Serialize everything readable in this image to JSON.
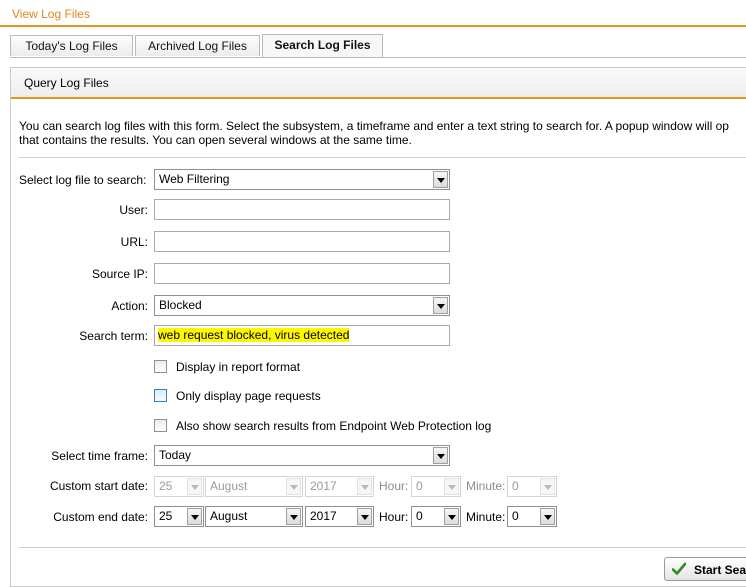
{
  "page": {
    "title": "View Log Files"
  },
  "tabs": [
    {
      "label": "Today's Log Files",
      "active": false
    },
    {
      "label": "Archived Log Files",
      "active": false
    },
    {
      "label": "Search Log Files",
      "active": true
    }
  ],
  "panel": {
    "title": "Query Log Files",
    "intro_line1": "You can search log files with this form. Select the subsystem, a timeframe and enter a text string to search for. A popup window will op",
    "intro_line2": "that contains the results. You can open several windows at the same time."
  },
  "form": {
    "log_file": {
      "label": "Select log file to search:",
      "value": "Web Filtering"
    },
    "user": {
      "label": "User:",
      "value": ""
    },
    "url": {
      "label": "URL:",
      "value": ""
    },
    "source_ip": {
      "label": "Source IP:",
      "value": ""
    },
    "action": {
      "label": "Action:",
      "value": "Blocked"
    },
    "search_term": {
      "label": "Search term:",
      "value": "web request blocked, virus detected",
      "highlight": "#fff700"
    },
    "checkboxes": {
      "report_format": {
        "label": "Display in report format",
        "checked": false
      },
      "page_requests": {
        "label": "Only display page requests",
        "checked": false
      },
      "endpoint": {
        "label": "Also show search results from Endpoint Web Protection log",
        "checked": false
      }
    },
    "time_frame": {
      "label": "Select time frame:",
      "value": "Today"
    },
    "start_date": {
      "label": "Custom start date:",
      "day": "25",
      "month": "August",
      "year": "2017",
      "hour_label": "Hour:",
      "hour": "0",
      "minute_label": "Minute:",
      "minute": "0",
      "disabled": true
    },
    "end_date": {
      "label": "Custom end date:",
      "day": "25",
      "month": "August",
      "year": "2017",
      "hour_label": "Hour:",
      "hour": "0",
      "minute_label": "Minute:",
      "minute": "0",
      "disabled": false
    }
  },
  "actions": {
    "start_search_label": "Start Sea",
    "icon": "checkmark-icon"
  },
  "colors": {
    "accent": "#e8951f",
    "title": "#e0881c",
    "checkmark": "#2e8b1e"
  }
}
